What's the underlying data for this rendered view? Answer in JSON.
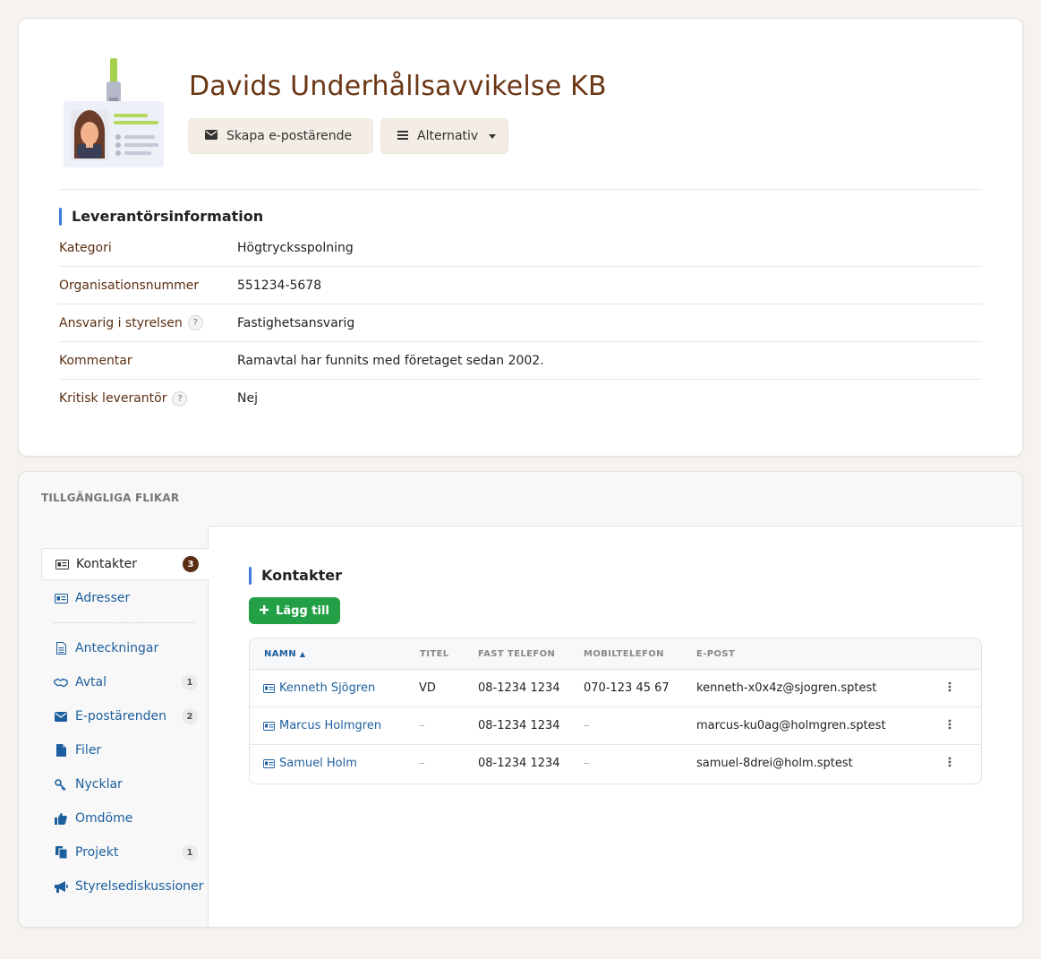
{
  "header": {
    "company_name": "Davids Underhållsavvikelse KB",
    "email_button_label": "Skapa e-postärende",
    "options_button_label": "Alternativ"
  },
  "supplier_info": {
    "title": "Leverantörsinformation",
    "rows": [
      {
        "label": "Kategori",
        "value": "Högtrycksspolning",
        "help": false
      },
      {
        "label": "Organisationsnummer",
        "value": "551234-5678",
        "help": false
      },
      {
        "label": "Ansvarig i styrelsen",
        "value": "Fastighetsansvarig",
        "help": true
      },
      {
        "label": "Kommentar",
        "value": "Ramavtal har funnits med företaget sedan 2002.",
        "help": false
      },
      {
        "label": "Kritisk leverantör",
        "value": "Nej",
        "help": true
      }
    ],
    "help_glyph": "?"
  },
  "tabs": {
    "heading": "TILLGÄNGLIGA FLIKAR",
    "items": [
      {
        "label": "Kontakter",
        "badge": "3",
        "icon": "contact-card-icon"
      },
      {
        "label": "Adresser",
        "badge": "",
        "icon": "address-card-icon"
      },
      {
        "label": "Anteckningar",
        "badge": "",
        "icon": "note-icon"
      },
      {
        "label": "Avtal",
        "badge": "1",
        "icon": "handshake-icon"
      },
      {
        "label": "E-postärenden",
        "badge": "2",
        "icon": "envelope-icon"
      },
      {
        "label": "Filer",
        "badge": "",
        "icon": "file-icon"
      },
      {
        "label": "Nycklar",
        "badge": "",
        "icon": "key-icon"
      },
      {
        "label": "Omdöme",
        "badge": "",
        "icon": "thumbs-up-icon"
      },
      {
        "label": "Projekt",
        "badge": "1",
        "icon": "copy-icon"
      },
      {
        "label": "Styrelsediskussioner",
        "badge": "",
        "icon": "megaphone-icon"
      }
    ]
  },
  "contacts": {
    "title": "Kontakter",
    "add_button_label": "Lägg till",
    "columns": {
      "name": "NAMN",
      "title": "TITEL",
      "phone": "FAST TELEFON",
      "mobile": "MOBILTELEFON",
      "email": "E-POST"
    },
    "rows": [
      {
        "name": "Kenneth Sjögren",
        "title": "VD",
        "phone": "08-1234 1234",
        "mobile": "070-123 45 67",
        "email": "kenneth-x0x4z@sjogren.sptest"
      },
      {
        "name": "Marcus Holmgren",
        "title": "–",
        "phone": "08-1234 1234",
        "mobile": "–",
        "email": "marcus-ku0ag@holmgren.sptest"
      },
      {
        "name": "Samuel Holm",
        "title": "–",
        "phone": "08-1234 1234",
        "mobile": "–",
        "email": "samuel-8drei@holm.sptest"
      }
    ]
  },
  "colors": {
    "brand_brown": "#6b3614",
    "link_blue": "#1d5f9e",
    "accent_blue": "#3b7ddd",
    "add_green": "#23a046",
    "page_bg": "#f6f3ee"
  }
}
